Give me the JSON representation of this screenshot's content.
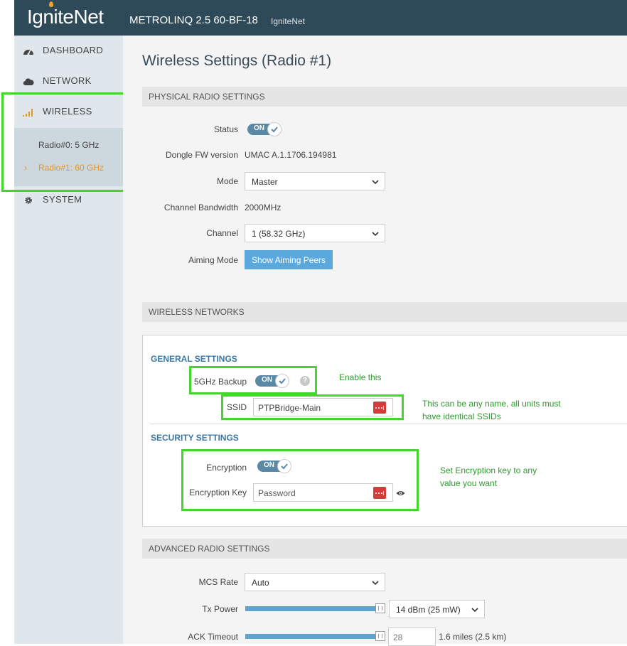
{
  "header": {
    "logo": "IgniteNet",
    "device_name": "METROLINQ 2.5 60-BF-18",
    "brand": "IgniteNet"
  },
  "sidebar": {
    "items": [
      {
        "label": "DASHBOARD",
        "icon": "dashboard-icon"
      },
      {
        "label": "NETWORK",
        "icon": "cloud-icon"
      },
      {
        "label": "WIRELESS",
        "icon": "signal-bars-icon"
      },
      {
        "label": "SYSTEM",
        "icon": "gear-icon"
      }
    ],
    "wireless_sub": [
      {
        "label": "Radio#0: 5 GHz"
      },
      {
        "label": "Radio#1: 60 GHz",
        "active": true
      }
    ],
    "active_color": "#e0962a"
  },
  "page": {
    "title": "Wireless Settings (Radio #1)"
  },
  "physical": {
    "section_title": "PHYSICAL RADIO SETTINGS",
    "status_label": "Status",
    "status_toggle": "ON",
    "dongle_label": "Dongle FW version",
    "dongle_value": "UMAC A.1.1706.194981",
    "mode_label": "Mode",
    "mode_value": "Master",
    "bandwidth_label": "Channel Bandwidth",
    "bandwidth_value": "2000MHz",
    "channel_label": "Channel",
    "channel_value": "1 (58.32 GHz)",
    "aiming_label": "Aiming Mode",
    "aiming_button": "Show Aiming Peers"
  },
  "wireless_networks": {
    "section_title": "WIRELESS NETWORKS",
    "general_title": "GENERAL SETTINGS",
    "backup_label": "5GHz Backup",
    "backup_toggle": "ON",
    "ssid_label": "SSID",
    "ssid_value": "PTPBridge-Main",
    "security_title": "SECURITY SETTINGS",
    "encryption_label": "Encryption",
    "encryption_toggle": "ON",
    "key_label": "Encryption Key",
    "key_placeholder": "Password"
  },
  "annotations": {
    "enable": "Enable this",
    "ssid_note_1": "This can be any name, all units must",
    "ssid_note_2": "have identical SSIDs",
    "key_note_1": "Set Encryption key to any",
    "key_note_2": "value you want",
    "highlight_color": "#44d62c"
  },
  "advanced": {
    "section_title": "ADVANCED RADIO SETTINGS",
    "mcs_label": "MCS Rate",
    "mcs_value": "Auto",
    "tx_label": "Tx Power",
    "tx_value": "14 dBm (25 mW)",
    "ack_label": "ACK Timeout",
    "ack_value": "28",
    "ack_distance": "1.6 miles (2.5 km)"
  }
}
